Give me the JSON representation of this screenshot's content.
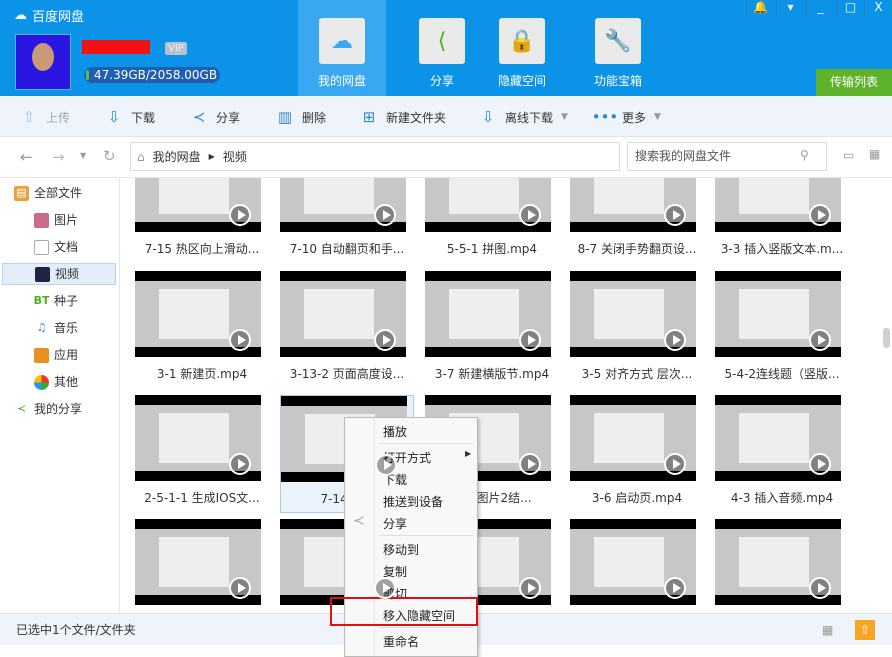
{
  "app": {
    "title": "百度网盘",
    "quota": "47.39GB/2058.00GB",
    "vip": "VIP"
  },
  "top_tabs": [
    {
      "label": "我的网盘",
      "icon": "cloud-icon"
    },
    {
      "label": "分享",
      "icon": "share-icon"
    },
    {
      "label": "隐藏空间",
      "icon": "lock-icon"
    },
    {
      "label": "功能宝箱",
      "icon": "wrench-icon"
    }
  ],
  "window": {
    "bell": "🔔",
    "menu": "▾",
    "min": "_",
    "max": "□",
    "close": "X"
  },
  "transfer": "传输列表",
  "toolbar": {
    "upload": "上传",
    "download": "下载",
    "share": "分享",
    "delete": "删除",
    "new_folder": "新建文件夹",
    "offline": "离线下载",
    "more": "更多"
  },
  "nav": {
    "root": "我的网盘",
    "current": "视频",
    "search_placeholder": "搜索我的网盘文件"
  },
  "sidebar": [
    {
      "label": "全部文件"
    },
    {
      "label": "图片"
    },
    {
      "label": "文档"
    },
    {
      "label": "视频"
    },
    {
      "label": "种子"
    },
    {
      "label": "音乐"
    },
    {
      "label": "应用"
    },
    {
      "label": "其他"
    },
    {
      "label": "我的分享"
    }
  ],
  "files": [
    "7-15  热区向上滑动...",
    "7-10  自动翻页和手...",
    "5-5-1 拼图.mp4",
    "8-7  关闭手势翻页设...",
    "3-3  插入竖版文本.m...",
    "3-1  新建页.mp4",
    "3-13-2  页面高度设...",
    "3-7  新建横版节.mp4",
    "3-5  对齐方式 层次...",
    "5-4-2连线题（竖版...",
    "2-5-1-1  生成IOS文...",
    "7-14  图片",
    "触摸图片2结...",
    "3-6  启动页.mp4",
    "4-3  插入音频.mp4",
    "",
    "",
    "",
    "",
    ""
  ],
  "context_menu": [
    "播放",
    "打开方式",
    "下载",
    "推送到设备",
    "分享",
    "移动到",
    "复制",
    "剪切",
    "移入隐藏空间",
    "重命名"
  ],
  "status": "已选中1个文件/文件夹"
}
